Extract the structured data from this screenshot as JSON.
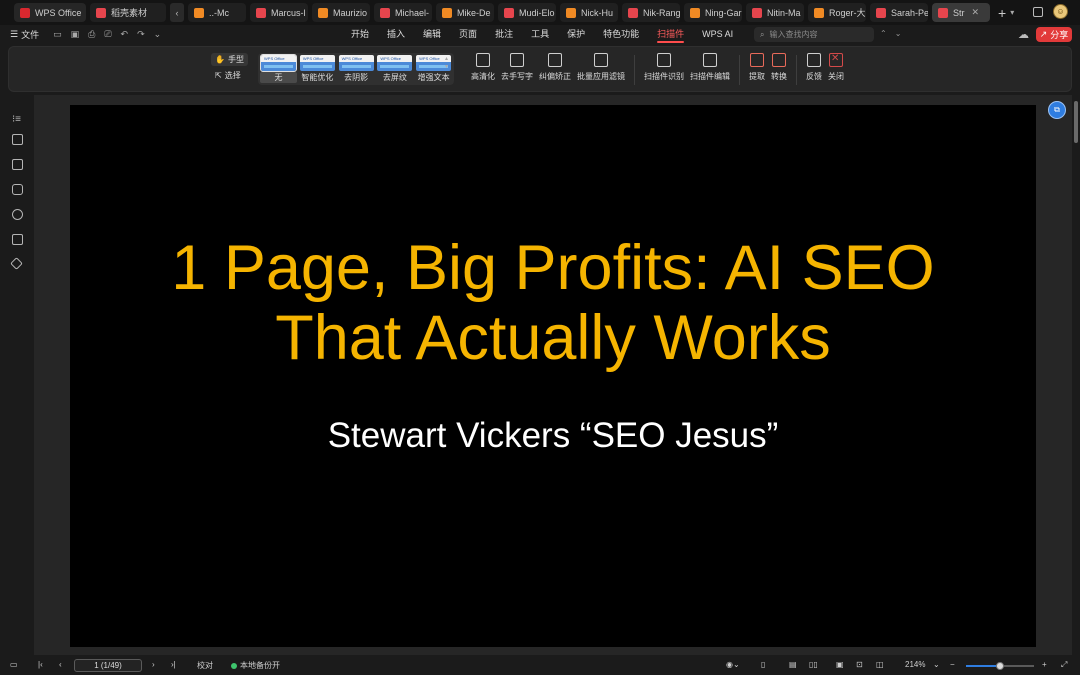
{
  "tabs": {
    "home": "WPS Office",
    "first": "稻壳素材",
    "docs": [
      "..-Mc",
      "Marcus-l",
      "Maurizio",
      "Michael-",
      "Mike-De",
      "Mudi-Elo",
      "Nick-Hu",
      "Nik-Rang",
      "Ning-Gar",
      "Nitin-Ma",
      "Roger-大",
      "Sarah-Pe"
    ],
    "active": "Str"
  },
  "menubar": {
    "file": "文件",
    "items": [
      "开始",
      "插入",
      "编辑",
      "页面",
      "批注",
      "工具",
      "保护",
      "特色功能",
      "扫描件",
      "WPS AI"
    ],
    "active_index": 8,
    "search_placeholder": "输入查找内容",
    "share": "分享"
  },
  "ribbon": {
    "hand": "手型",
    "select": "选择",
    "filters": [
      "无",
      "智能优化",
      "去阴影",
      "去屏纹",
      "增强文本"
    ],
    "selected_filter": 0,
    "tools_group1": [
      "高清化",
      "去手写字",
      "纠偏矫正",
      "批量应用滤镜"
    ],
    "tools_group2": [
      "扫描件识别",
      "扫描件编辑"
    ],
    "tools_group3": [
      "提取",
      "转换"
    ],
    "tools_group4": [
      "反馈",
      "关闭"
    ]
  },
  "slide": {
    "title_line1": "1 Page, Big Profits: AI SEO",
    "title_line2": "That Actually Works",
    "subtitle": "Stewart Vickers “SEO Jesus”",
    "title_color": "#f5b400"
  },
  "statusbar": {
    "page": "1 (1/49)",
    "proof": "校对",
    "backup": "本地备份开",
    "zoom": "214%",
    "zoom_fraction": 0.5
  }
}
